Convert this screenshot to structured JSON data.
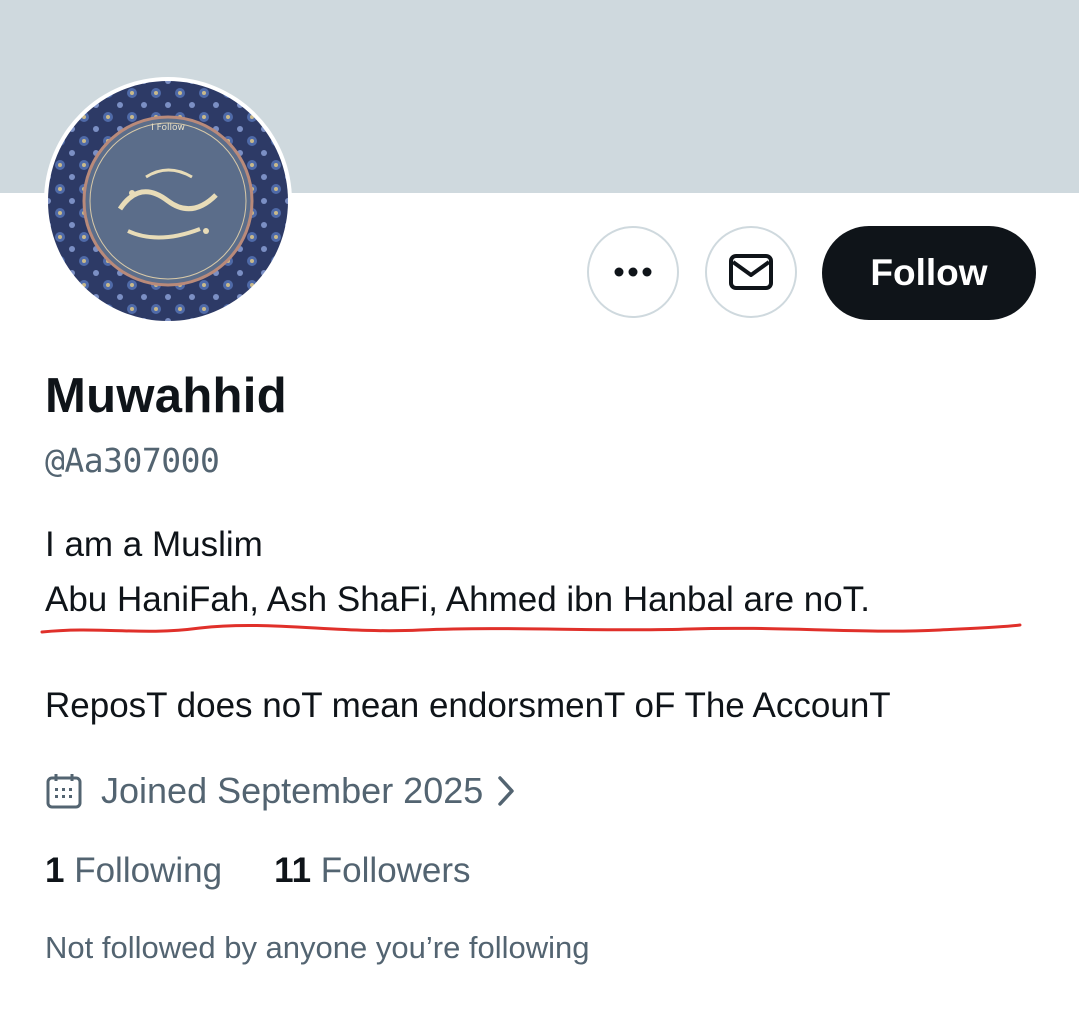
{
  "profile": {
    "avatar_caption": "I Follow",
    "display_name": "Muwahhid",
    "handle": "@Aa307000",
    "bio": {
      "line1": "I am a Muslim",
      "line2": "Abu HaniFah, Ash ShaFi, Ahmed ibn Hanbal are noT.",
      "line3": "ReposT does noT mean endorsmenT oF The AccounT"
    },
    "joined": "Joined September 2025",
    "following_count": "1",
    "following_label": "Following",
    "followers_count": "11",
    "followers_label": "Followers",
    "mutuals_note": "Not followed by anyone you’re following"
  },
  "actions": {
    "follow_label": "Follow",
    "more_icon": "more-icon",
    "message_icon": "envelope-icon"
  },
  "colors": {
    "banner": "#cfd9de",
    "follow_button": "#0f1419",
    "secondary_text": "#536471",
    "underline": "#e0302a"
  }
}
